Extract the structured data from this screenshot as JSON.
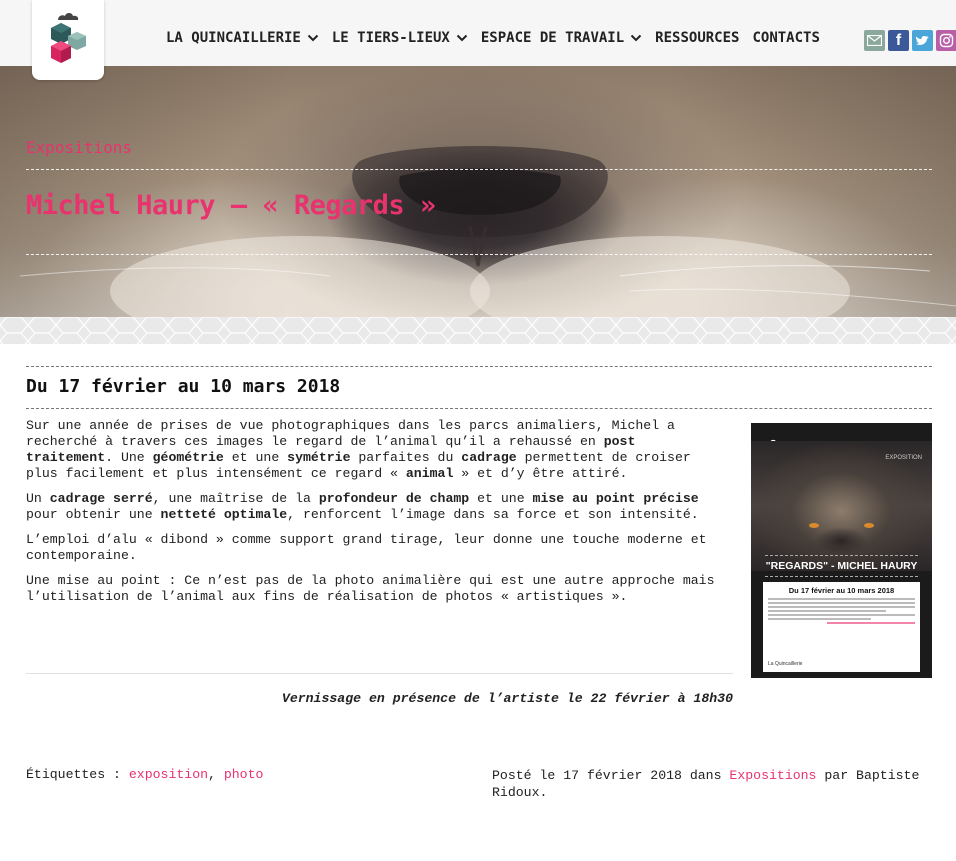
{
  "header": {
    "nav": [
      {
        "label": "LA QUINCAILLERIE",
        "dropdown": true
      },
      {
        "label": "LE TIERS-LIEUX",
        "dropdown": true
      },
      {
        "label": "ESPACE DE TRAVAIL",
        "dropdown": true
      },
      {
        "label": "RESSOURCES",
        "dropdown": false
      },
      {
        "label": "CONTACTS",
        "dropdown": false
      }
    ],
    "social": [
      "mail-icon",
      "facebook-icon",
      "twitter-icon",
      "instagram-icon"
    ],
    "facebook_glyph": "f"
  },
  "hero": {
    "category": "Expositions",
    "title": "Michel Haury – « Regards »"
  },
  "article": {
    "date_heading": "Du 17 février au 10 mars 2018",
    "p1": {
      "t1": "Sur une année de prises de vue photographiques dans les parcs animaliers, Michel a recherché à travers ces images le regard de l’animal qu’il a rehaussé en ",
      "b1": "post traitement",
      "t2": ". Une ",
      "b2": "géométrie",
      "t3": " et une ",
      "b3": "symétrie",
      "t4": " parfaites du ",
      "b4": "cadrage",
      "t5": " permettent de croiser plus facilement et plus intensément ce regard « ",
      "b5": "animal",
      "t6": " » et d’y être attiré."
    },
    "p2": {
      "t1": "Un ",
      "b1": "cadrage serré",
      "t2": ", une maîtrise de la ",
      "b2": "profondeur de champ",
      "t3": " et une ",
      "b3": "mise au point précise",
      "t4": " pour obtenir une ",
      "b4": "netteté optimale",
      "t5": ", renforcent l’image dans sa force et son intensité."
    },
    "p3": "L’emploi d’alu « dibond » comme support grand tirage, leur donne une touche moderne et contemporaine.",
    "p4": "Une mise au point : Ce n’est pas de la photo animalière qui est une autre approche mais l’utilisation de l’animal aux fins de réalisation de photos « artistiques ».",
    "vernissage": "Vernissage en présence de l’artiste le 22 février à 18h30"
  },
  "poster": {
    "label": "EXPOSITION",
    "heading": "\"REGARDS\" - MICHEL HAURY",
    "date": "Du 17 février au 10 mars 2018",
    "logo_text": "La Quincaillerie"
  },
  "footer_meta": {
    "tags_label": "Étiquettes : ",
    "tags": [
      "exposition",
      "photo"
    ],
    "tag_separator": ", ",
    "posted_prefix": "Posté le 17 février 2018 dans ",
    "posted_category": "Expositions",
    "posted_suffix": " par Baptiste Ridoux."
  },
  "colors": {
    "accent": "#e8336e",
    "logo_cube_1": "#2c5a5a",
    "logo_cube_2": "#7fa8a2",
    "logo_cube_3": "#d6245f"
  }
}
